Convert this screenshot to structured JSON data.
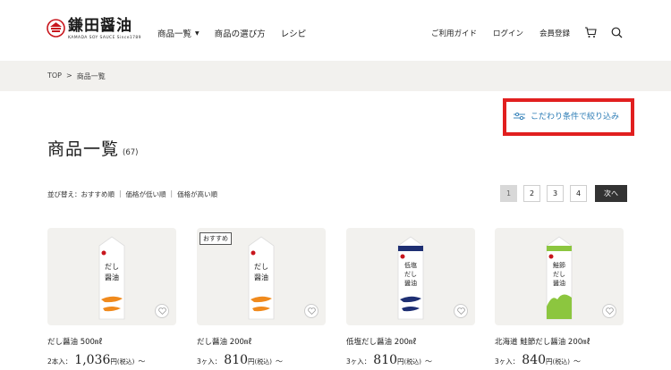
{
  "header": {
    "logo_name": "鎌田醤油",
    "logo_sub": "KAMADA SOY SAUCE Since1789",
    "nav_main": [
      "商品一覧",
      "商品の選び方",
      "レシピ"
    ],
    "nav_right": [
      "ご利用ガイド",
      "ログイン",
      "会員登録"
    ]
  },
  "breadcrumb": {
    "home": "TOP",
    "separator": ">",
    "current": "商品一覧"
  },
  "filter": {
    "label": "こだわり条件で絞り込み"
  },
  "title": {
    "text": "商品一覧",
    "count": "(67)"
  },
  "sort": {
    "prefix": "並び替え：",
    "options": [
      "おすすめ順",
      "価格が低い順",
      "価格が高い順"
    ]
  },
  "pagination": {
    "pages": [
      "1",
      "2",
      "3",
      "4"
    ],
    "current": "1",
    "next": "次へ"
  },
  "products": [
    {
      "name": "だし醤油 500㎖",
      "qty": "2本入：",
      "price": "1,036",
      "unit": "円",
      "tax": "(税込)",
      "tilde": "〜",
      "badge": "",
      "color": "#f08a1d",
      "label": "だし醤油"
    },
    {
      "name": "だし醤油 200㎖",
      "qty": "3ヶ入：",
      "price": "810",
      "unit": "円",
      "tax": "(税込)",
      "tilde": "〜",
      "badge": "おすすめ",
      "color": "#f08a1d",
      "label": "だし醤油"
    },
    {
      "name": "低塩だし醤油 200㎖",
      "qty": "3ヶ入：",
      "price": "810",
      "unit": "円",
      "tax": "(税込)",
      "tilde": "〜",
      "badge": "",
      "color": "#1e2f73",
      "label": "低塩だし醤油"
    },
    {
      "name": "北海道 鮭節だし醤油 200㎖",
      "qty": "3ヶ入：",
      "price": "840",
      "unit": "円",
      "tax": "(税込)",
      "tilde": "〜",
      "badge": "",
      "color": "#8cc63f",
      "label": "鮭節だし醤油"
    }
  ],
  "colors": {
    "accent": "#2a7bb5",
    "highlight": "#e11f1f",
    "card_bg": "#f2f1ee",
    "logo_red": "#c8161d"
  },
  "icons": {
    "cart": "cart-icon",
    "search": "search-icon",
    "filter": "filter-icon",
    "favorite": "heart-icon"
  }
}
